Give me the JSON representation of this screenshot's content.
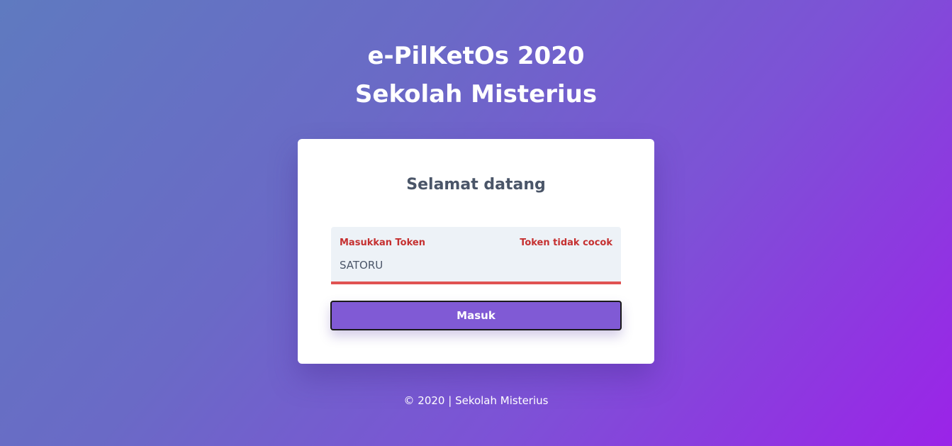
{
  "header": {
    "title_line1": "e-PilKetOs 2020",
    "title_line2": "Sekolah Misterius"
  },
  "card": {
    "title": "Selamat datang",
    "token_field": {
      "label": "Masukkan Token",
      "error": "Token tidak cocok",
      "value": "SATORU"
    },
    "submit_label": "Masuk"
  },
  "footer": {
    "text": "© 2020 | Sekolah Misterius"
  },
  "colors": {
    "accent": "#805ad5",
    "error": "#c53030",
    "error_border": "#e05252",
    "gradient_start": "#5f7ac0",
    "gradient_end": "#9b23e8"
  }
}
